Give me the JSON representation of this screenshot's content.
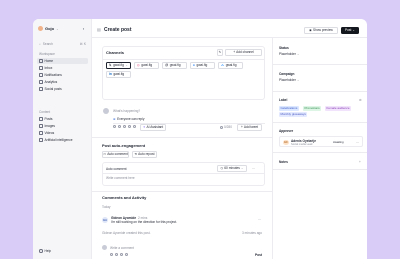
{
  "sidebar": {
    "user": "Gojo",
    "search_placeholder": "Search",
    "search_shortcut": "⌘ K",
    "workspace_label": "Workspace",
    "items": [
      {
        "label": "Home",
        "active": true
      },
      {
        "label": "Inbox",
        "active": false
      },
      {
        "label": "Notifications",
        "active": false
      },
      {
        "label": "Analytics",
        "active": false
      },
      {
        "label": "Social posts",
        "active": false
      }
    ],
    "content_label": "Content",
    "content_items": [
      {
        "label": "Posts"
      },
      {
        "label": "Images"
      },
      {
        "label": "Videos"
      },
      {
        "label": "Artificial intelligence"
      }
    ],
    "help_label": "Help"
  },
  "header": {
    "title": "Create post",
    "preview_label": "Show preview",
    "post_label": "Post"
  },
  "channels": {
    "title": "Channels",
    "add_label": "Add channel",
    "accounts": [
      {
        "network": "X",
        "name": "gwai.fig"
      },
      {
        "network": "Instagram",
        "name": "gwai.fig"
      },
      {
        "network": "Threads",
        "name": "gwai.fig"
      },
      {
        "network": "Facebook",
        "name": "gwai.fig"
      },
      {
        "network": "Bluesky",
        "name": "gwai.fig"
      },
      {
        "network": "LinkedIn",
        "name": "gwai.fig"
      }
    ]
  },
  "composer": {
    "placeholder": "What's happening?",
    "reply_setting": "Everyone can reply",
    "ai_label": "AI Assistant",
    "char_count": "0/280",
    "add_tweet_label": "Add tweet"
  },
  "engagement": {
    "title": "Post auto-engagement",
    "auto_comment_label": "Auto comment",
    "auto_repost_label": "Auto repost",
    "card_title": "Auto comment",
    "delay_value": "60 minutes",
    "comment_placeholder": "Write comment here"
  },
  "activity": {
    "title": "Comments and Activity",
    "today_label": "Today",
    "comment": {
      "author": "Gideon Ayomide",
      "time": "2 mins",
      "text": "I'm still working on the direction for this project.",
      "initials": "GA"
    },
    "event": {
      "text": "Gideon Ayomide created this post.",
      "time": "3 minutes ago"
    },
    "reply_placeholder": "Write a comment",
    "post_label": "Post"
  },
  "rail": {
    "status_label": "Status",
    "status_value": "Placeholder",
    "campaign_label": "Campaign",
    "campaign_value": "Placeholder",
    "label_title": "Label",
    "tags": [
      {
        "text": "Celebrations",
        "color": "#dbe7ff",
        "fg": "#3b5bc7"
      },
      {
        "text": "Promotions",
        "color": "#dcf5e4",
        "fg": "#2f8a4e"
      },
      {
        "text": "Female audience",
        "color": "#f1e3fb",
        "fg": "#8a3fb8"
      },
      {
        "text": "Monthly giveaways",
        "color": "#e3e9ff",
        "fg": "#4a5bc0"
      }
    ],
    "approver_label": "Approver",
    "approver": {
      "initials": "AO",
      "name": "Adenis Oyelarije",
      "role": "Social media Lead",
      "status": "Awaiting"
    },
    "notes_label": "Notes"
  },
  "colors": {
    "background": "#d9ccf7",
    "accent_dark": "#15171e",
    "ai_purple": "#7a5cf0"
  }
}
